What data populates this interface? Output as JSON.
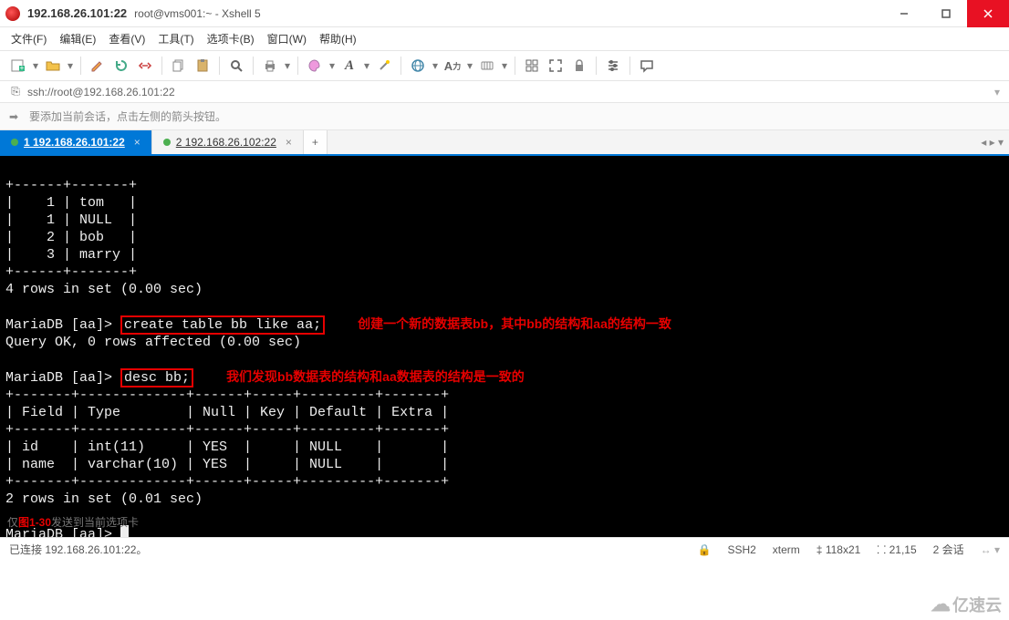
{
  "titlebar": {
    "host": "192.168.26.101:22",
    "sub": "root@vms001:~ - Xshell 5"
  },
  "menu": {
    "file": "文件(F)",
    "edit": "编辑(E)",
    "view": "查看(V)",
    "tools": "工具(T)",
    "tabs": "选项卡(B)",
    "window": "窗口(W)",
    "help": "帮助(H)"
  },
  "addrbar": {
    "url": "ssh://root@192.168.26.101:22"
  },
  "hintbar": {
    "text": "要添加当前会话，点击左侧的箭头按钮。"
  },
  "tabs": {
    "t1": "1 192.168.26.101:22",
    "t2": "2 192.168.26.102:22"
  },
  "term": {
    "row_sep": "+------+-------+",
    "row1": "|    1 | tom   |",
    "row2": "|    1 | NULL  |",
    "row3": "|    2 | bob   |",
    "row4": "|    3 | marry |",
    "rows_set": "4 rows in set (0.00 sec)",
    "prompt1_pre": "MariaDB [aa]> ",
    "cmd1": "create table bb like aa;",
    "annot1": "创建一个新的数据表bb，其中bb的结构和aa的结构一致",
    "result1": "Query OK, 0 rows affected (0.00 sec)",
    "prompt2_pre": "MariaDB [aa]> ",
    "cmd2": "desc bb;",
    "annot2": "我们发现bb数据表的结构和aa数据表的结构是一致的",
    "desc_sep": "+-------+-------------+------+-----+---------+-------+",
    "desc_hdr": "| Field | Type        | Null | Key | Default | Extra |",
    "desc_r1": "| id    | int(11)     | YES  |     | NULL    |       |",
    "desc_r2": "| name  | varchar(10) | YES  |     | NULL    |       |",
    "rows_set2": "2 rows in set (0.01 sec)",
    "prompt3": "MariaDB [aa]> ",
    "bottom_hint_a": "仅",
    "figlabel": "图1-30",
    "bottom_hint_b": "发送到当前选项卡"
  },
  "statusbar": {
    "conn": "已连接 192.168.26.101:22。",
    "ssh": "SSH2",
    "term": "xterm",
    "size": "118x21",
    "pos": "21,15",
    "sessions": "2 会话"
  },
  "watermark": {
    "text": "亿速云"
  },
  "icons": {
    "newtab": "plus",
    "open": "folder",
    "edit": "pencil",
    "reconnect": "refresh",
    "disconnect": "unplug",
    "copy": "copy",
    "paste": "paste",
    "search": "magnify",
    "print": "printer",
    "color": "palette",
    "font": "A",
    "profile": "wand",
    "globe": "globe",
    "keymap": "keyboard",
    "lang": "lang",
    "synctabs": "grid",
    "fullscreen": "expand",
    "lock": "lock",
    "settings": "sliders",
    "help": "bubble"
  }
}
